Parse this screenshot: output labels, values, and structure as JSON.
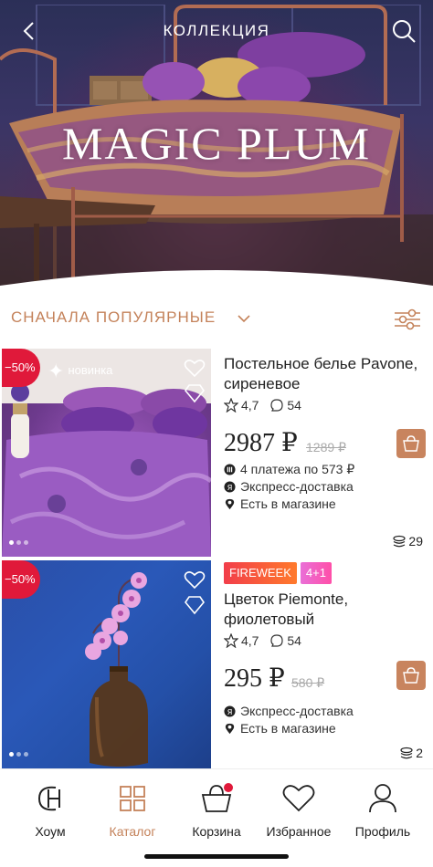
{
  "header": {
    "title": "КОЛЛЕКЦИЯ",
    "hero_title": "MAGIC PLUM",
    "back_icon": "chevron-left-icon",
    "search_icon": "search-icon"
  },
  "sort": {
    "label": "СНАЧАЛА ПОПУЛЯРНЫЕ",
    "filter_icon": "filter-sliders-icon"
  },
  "products": [
    {
      "name": "Постельное белье Pavone, сиреневое",
      "discount": "−50%",
      "new_badge": "новинка",
      "rating": "4,7",
      "reviews": "54",
      "price": "2987 ₽",
      "old_price": "1289 ₽",
      "installments": "4 платежа по 573 ₽",
      "delivery": "Экспресс-доставка",
      "store": "Есть в магазине",
      "stock": "29",
      "tags": []
    },
    {
      "name": "Цветок Piemonte, фиолетовый",
      "discount": "−50%",
      "rating": "4,7",
      "reviews": "54",
      "price": "295 ₽",
      "old_price": "580 ₽",
      "delivery": "Экспресс-доставка",
      "store": "Есть в магазине",
      "stock": "2",
      "tags": [
        "FIREWEEK",
        "4+1"
      ]
    }
  ],
  "tabs": [
    {
      "label": "Хоум",
      "icon": "brand-logo-icon",
      "active": false
    },
    {
      "label": "Каталог",
      "icon": "grid-icon",
      "active": true
    },
    {
      "label": "Корзина",
      "icon": "basket-icon",
      "active": false
    },
    {
      "label": "Избранное",
      "icon": "heart-icon",
      "active": false
    },
    {
      "label": "Профиль",
      "icon": "user-icon",
      "active": false
    }
  ],
  "colors": {
    "accent": "#c4825a",
    "sale": "#e0193a",
    "cart_button": "#c8845e"
  }
}
